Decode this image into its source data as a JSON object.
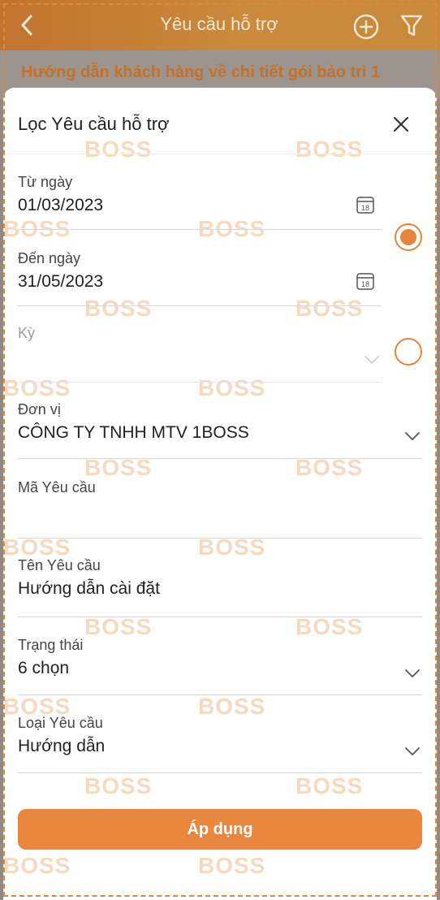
{
  "nav": {
    "title": "Yêu cầu hỗ trợ"
  },
  "background_item": {
    "title": "Hướng dẫn khách hàng về chi tiết gói bảo trì 1"
  },
  "sheet": {
    "title": "Lọc Yêu cầu hỗ trợ",
    "watermark": "BOSS",
    "fields": {
      "from_date": {
        "label": "Từ ngày",
        "value": "01/03/2023",
        "calendar_day": "18"
      },
      "to_date": {
        "label": "Đến ngày",
        "value": "31/05/2023",
        "calendar_day": "18"
      },
      "period": {
        "label": "Kỳ",
        "value": ""
      },
      "unit": {
        "label": "Đơn vị",
        "value": "CÔNG TY TNHH MTV 1BOSS"
      },
      "request_code": {
        "label": "Mã Yêu cầu",
        "value": ""
      },
      "request_name": {
        "label": "Tên Yêu cầu",
        "value": "Hướng dẫn cài đặt"
      },
      "status": {
        "label": "Trạng thái",
        "value": "6 chọn"
      },
      "request_type": {
        "label": "Loại Yêu cầu",
        "value": "Hướng dẫn"
      }
    },
    "radio": {
      "date_range_selected": true,
      "period_selected": false
    },
    "apply_label": "Áp dụng"
  },
  "colors": {
    "accent": "#e8873d",
    "nav_bar": "#c98a3c",
    "watermark": "#f6d9bf"
  },
  "icons": {
    "back": "chevron-left-icon",
    "add": "plus-circle-icon",
    "filter": "filter-icon",
    "close": "close-icon",
    "calendar": "calendar-icon",
    "dropdown": "chevron-down-icon"
  }
}
